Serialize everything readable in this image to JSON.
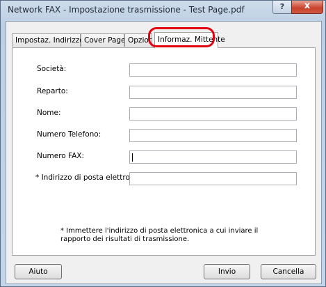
{
  "window": {
    "title": "Network FAX - Impostazione trasmissione - Test Page.pdf",
    "help_label": "?",
    "close_label": "x"
  },
  "tabs": [
    {
      "label": "Impostaz. Indirizzo",
      "active": false
    },
    {
      "label": "Cover Page",
      "active": false
    },
    {
      "label": "Opzior",
      "active": false
    },
    {
      "label": "Informaz. Mittente",
      "active": true
    }
  ],
  "form": {
    "fields": [
      {
        "label": "Società:",
        "value": ""
      },
      {
        "label": "Reparto:",
        "value": ""
      },
      {
        "label": "Nome:",
        "value": ""
      },
      {
        "label": "Numero Telefono:",
        "value": ""
      },
      {
        "label": "Numero FAX:",
        "value": ""
      },
      {
        "label": "* Indirizzo di posta elettronica:",
        "value": ""
      }
    ],
    "note": "* Immettere l'indirizzo di posta elettronica a cui inviare il rapporto dei risultati di trasmissione."
  },
  "buttons": {
    "help": "Aiuto",
    "send": "Invio",
    "cancel": "Cancella"
  },
  "colors": {
    "highlight": "#e3000f",
    "close_button": "#c8412b"
  }
}
